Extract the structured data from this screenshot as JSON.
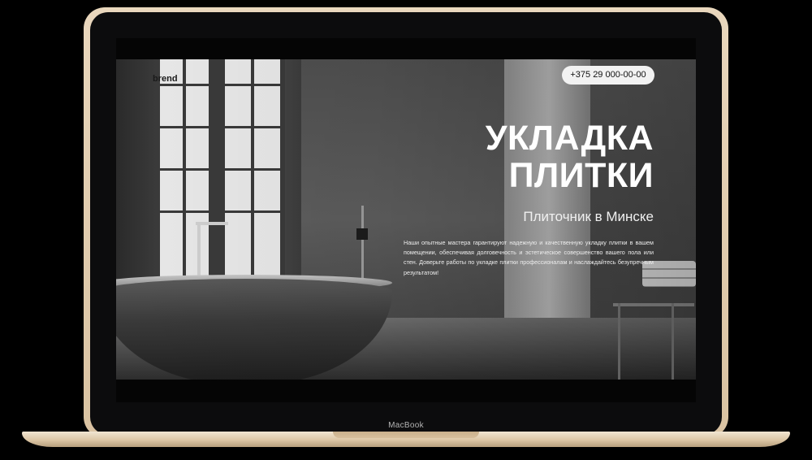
{
  "device": {
    "brand_label": "MacBook"
  },
  "site": {
    "logo": "brend",
    "phone": "+375 29 000-00-00",
    "title_line1": "УКЛАДКА",
    "title_line2": "ПЛИТКИ",
    "subtitle": "Плиточник в Минске",
    "description": "Наши опытные мастера гарантируют надежную и качественную укладку плитки в вашем помещении, обеспечивая долговечность и эстетическое совершенство вашего пола или стен. Доверьте работы по укладке плитки профессионалам и наслаждайтесь безупречным результатом!"
  },
  "colors": {
    "frame": "#e3cfb2",
    "bezel": "#0c0c0d",
    "text": "#ffffff",
    "phone_button_bg": "#f2f2f2"
  }
}
